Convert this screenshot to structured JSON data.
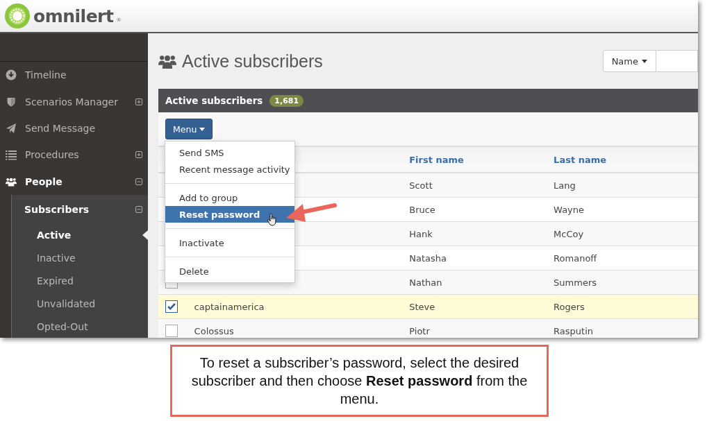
{
  "header": {
    "logo_text": "omnilert",
    "logo_mark": "®"
  },
  "sidebar": {
    "items": [
      {
        "label": "Timeline",
        "selected": false
      },
      {
        "label": "Scenarios Manager",
        "selected": false,
        "expanded": false
      },
      {
        "label": "Send Message",
        "selected": false
      },
      {
        "label": "Procedures",
        "selected": false,
        "expanded": false
      },
      {
        "label": "People",
        "selected": true,
        "expanded": true,
        "children": [
          {
            "label": "Subscribers",
            "expanded": true,
            "children": [
              {
                "label": "Active",
                "selected": true
              },
              {
                "label": "Inactive",
                "selected": false
              },
              {
                "label": "Expired",
                "selected": false
              },
              {
                "label": "Unvalidated",
                "selected": false
              },
              {
                "label": "Opted-Out",
                "selected": false
              }
            ]
          }
        ]
      }
    ]
  },
  "page": {
    "title": "Active subscribers",
    "search": {
      "field": "Name"
    }
  },
  "panel": {
    "title": "Active subscribers",
    "count": "1,681",
    "menu_button": "Menu",
    "menu": {
      "groups": [
        [
          {
            "label": "Send SMS",
            "selected": false
          },
          {
            "label": "Recent message activity",
            "selected": false
          }
        ],
        [
          {
            "label": "Add to group",
            "selected": false
          },
          {
            "label": "Reset password",
            "selected": true
          }
        ],
        [
          {
            "label": "Inactivate",
            "selected": false
          }
        ],
        [
          {
            "label": "Delete",
            "selected": false
          }
        ]
      ]
    },
    "table": {
      "columns": [
        "First name",
        "Last name"
      ],
      "rows": [
        {
          "first": "Scott",
          "last": "Lang"
        },
        {
          "first": "Bruce",
          "last": "Wayne"
        },
        {
          "first": "Hank",
          "last": "McCoy"
        },
        {
          "first": "Natasha",
          "last": "Romanoff"
        },
        {
          "checked": false,
          "first": "Nathan",
          "last": "Summers"
        },
        {
          "checked": true,
          "username": "captainamerica",
          "first": "Steve",
          "last": "Rogers"
        },
        {
          "checked": false,
          "username": "Colossus",
          "first": "Piotr",
          "last": "Rasputin"
        }
      ]
    }
  },
  "callout": {
    "text": "To reset a subscriber’s password, select the desired subscriber and then choose **Reset password** from the menu."
  }
}
